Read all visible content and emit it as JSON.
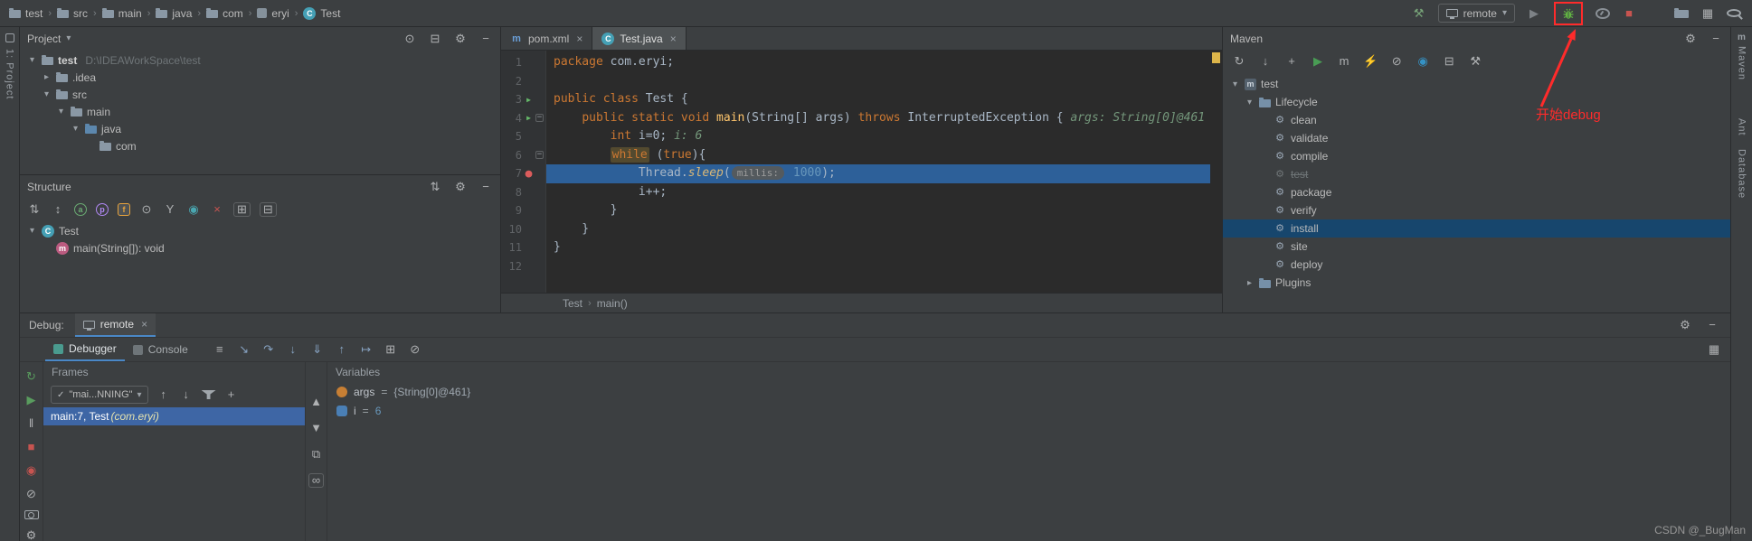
{
  "colors": {
    "panel_bg": "#3c3f41",
    "editor_bg": "#2b2b2b",
    "accent_blue": "#4a88c7",
    "selection_blue": "#3e66a5",
    "selection_dark": "#17466d",
    "execution_line_blue": "#2d6099",
    "keyword_orange": "#cc7832",
    "number_blue": "#6897bb",
    "inline_hint_green": "#74977b",
    "error_red": "#c75450",
    "run_green": "#499c54",
    "annotation_red": "#ff2b2b"
  },
  "icons": {
    "run": "▶",
    "stop": "■",
    "pause": "‖",
    "rerun": "↻",
    "gear": "⚙",
    "minus": "−",
    "close": "×",
    "chev_down": "▾",
    "chev_right": "▸",
    "sep": "›",
    "check": "✓",
    "up": "↑",
    "down": "↓",
    "plus": "+",
    "grid": "⊞",
    "layout": "▦",
    "bullseye": "⊙",
    "mute": "⊘",
    "infinity": "∞",
    "copy": "⧉",
    "tri_up": "▲",
    "tri_down": "▼",
    "sort": "⇅",
    "sort2": "↕",
    "step_over": "↷",
    "step_into": "↓",
    "force_step": "⇓",
    "step_out": "↑",
    "run_cursor": "↦",
    "show_exec": "↘",
    "hammer": "⚒",
    "lightning": "⚡",
    "circle": "◉",
    "dot": "●",
    "menu": "≡",
    "collapse": "⊟",
    "m_letter": "m",
    "a_letter": "a",
    "p_letter": "p",
    "f_letter": "f",
    "y_letter": "Y"
  },
  "top": {
    "breadcrumbs": [
      {
        "icon": "folder",
        "label": "test"
      },
      {
        "icon": "folder",
        "label": "src"
      },
      {
        "icon": "folder",
        "label": "main"
      },
      {
        "icon": "folder",
        "label": "java"
      },
      {
        "icon": "folder",
        "label": "com"
      },
      {
        "icon": "package",
        "label": "eryi"
      },
      {
        "icon": "class",
        "label": "Test"
      }
    ],
    "run_config": "remote",
    "annotation": "开始debug"
  },
  "left_stripe": {
    "label": "1: Project"
  },
  "project": {
    "header": "Project",
    "header_icons": [
      {
        "name": "locate-file-icon",
        "icon": "bullseye"
      },
      {
        "name": "collapse-all-icon",
        "icon": "collapse"
      },
      {
        "name": "settings-gear-icon",
        "icon": "gear"
      },
      {
        "name": "hide-panel-icon",
        "icon": "minus"
      }
    ],
    "tree": [
      {
        "indent": 0,
        "chev": "open",
        "icon": "folder",
        "label": "test",
        "bold": true,
        "extra": "D:\\IDEAWorkSpace\\test"
      },
      {
        "indent": 1,
        "chev": "closed",
        "icon": "folder",
        "label": ".idea"
      },
      {
        "indent": 1,
        "chev": "open",
        "icon": "folder",
        "label": "src"
      },
      {
        "indent": 2,
        "chev": "open",
        "icon": "folder",
        "label": "main"
      },
      {
        "indent": 3,
        "chev": "open",
        "icon": "folder-src",
        "label": "java"
      },
      {
        "indent": 4,
        "chev": "none",
        "icon": "folder",
        "label": "com"
      }
    ]
  },
  "structure": {
    "header": "Structure",
    "header_icons": [
      {
        "name": "sort-icon",
        "icon": "sort"
      },
      {
        "name": "settings-gear-icon",
        "icon": "gear"
      },
      {
        "name": "hide-panel-icon",
        "icon": "minus"
      }
    ],
    "toolbar_icons": [
      {
        "name": "sort-alphabetically-icon",
        "icon": "sort"
      },
      {
        "name": "sort-by-visibility-icon",
        "icon": "sort2"
      },
      {
        "name": "show-anonymous-classes-icon",
        "icon": "a_letter",
        "color": "#6aab73",
        "circle": true
      },
      {
        "name": "show-properties-icon",
        "icon": "p_letter",
        "color": "#b189f5",
        "circle": true
      },
      {
        "name": "show-fields-icon",
        "icon": "f_letter",
        "color": "#e8a33d",
        "circle": true,
        "active": true
      },
      {
        "name": "scroll-to-source-icon",
        "icon": "bullseye"
      },
      {
        "name": "show-inherited-icon",
        "icon": "y_letter"
      },
      {
        "name": "expand-node-icon",
        "icon": "circle",
        "color": "#49a6b0"
      },
      {
        "name": "remove-icon",
        "icon": "close",
        "color": "#c75450"
      },
      {
        "name": "autoscroll-to-source-icon",
        "icon": "grid",
        "boxed": true
      },
      {
        "name": "autoscroll-from-source-icon",
        "icon": "collapse",
        "boxed": true
      }
    ],
    "tree": [
      {
        "indent": 0,
        "chev": "open",
        "icon": "class",
        "label": "Test"
      },
      {
        "indent": 1,
        "chev": "none",
        "icon": "method",
        "label": "main(String[]): void"
      }
    ]
  },
  "editor": {
    "tabs": [
      {
        "icon": "maven-file",
        "label": "pom.xml",
        "close": true
      },
      {
        "icon": "class",
        "label": "Test.java",
        "close": true,
        "selected": true
      }
    ],
    "lines": [
      {
        "n": 1,
        "seg": [
          [
            "kw",
            "package"
          ],
          [
            "pl",
            " com.eryi;"
          ]
        ]
      },
      {
        "n": 2,
        "seg": []
      },
      {
        "n": 3,
        "run": true,
        "seg": [
          [
            "kw",
            "public class"
          ],
          [
            "pl",
            " Test {"
          ]
        ]
      },
      {
        "n": 4,
        "run": true,
        "fold": true,
        "seg": [
          [
            "pl",
            "    "
          ],
          [
            "kw",
            "public static void"
          ],
          [
            "fn",
            " main"
          ],
          [
            "pl",
            "(String[] args) "
          ],
          [
            "kw",
            "throws"
          ],
          [
            "pl",
            " InterruptedException { "
          ],
          [
            "hint",
            "args: String[0]@461"
          ]
        ]
      },
      {
        "n": 5,
        "seg": [
          [
            "pl",
            "        "
          ],
          [
            "kw",
            "int"
          ],
          [
            "pl",
            " i=0; "
          ],
          [
            "hint",
            "i: 6"
          ]
        ]
      },
      {
        "n": 6,
        "fold": true,
        "seg": [
          [
            "pl",
            "        "
          ],
          [
            "kwh",
            "while"
          ],
          [
            "pl",
            " ("
          ],
          [
            "kw",
            "true"
          ],
          [
            "pl",
            "){"
          ]
        ]
      },
      {
        "n": 7,
        "bp": true,
        "exec": true,
        "seg": [
          [
            "pl",
            "            Thread."
          ],
          [
            "fni",
            "sleep"
          ],
          [
            "pl",
            "("
          ],
          [
            "chip",
            "millis:"
          ],
          [
            "num",
            " 1000"
          ],
          [
            "pl",
            ");"
          ]
        ]
      },
      {
        "n": 8,
        "seg": [
          [
            "pl",
            "            i++;"
          ]
        ]
      },
      {
        "n": 9,
        "seg": [
          [
            "pl",
            "        }"
          ]
        ]
      },
      {
        "n": 10,
        "seg": [
          [
            "pl",
            "    }"
          ]
        ]
      },
      {
        "n": 11,
        "seg": [
          [
            "pl",
            "}"
          ]
        ]
      },
      {
        "n": 12,
        "seg": []
      }
    ],
    "breadcrumb": [
      {
        "label": "Test"
      },
      {
        "label": "main()"
      }
    ]
  },
  "maven": {
    "header": "Maven",
    "header_icons": [
      {
        "name": "settings-gear-icon",
        "icon": "gear"
      },
      {
        "name": "hide-panel-icon",
        "icon": "minus"
      }
    ],
    "toolbar_icons": [
      {
        "name": "reimport-maven-icon",
        "icon": "rerun"
      },
      {
        "name": "download-sources-icon",
        "icon": "down"
      },
      {
        "name": "add-maven-project-icon",
        "icon": "plus"
      },
      {
        "name": "run-maven-build-icon",
        "icon": "run",
        "color": "#499c54"
      },
      {
        "name": "execute-maven-goal-icon",
        "icon": "m_letter"
      },
      {
        "name": "toggle-offline-icon",
        "icon": "lightning"
      },
      {
        "name": "skip-tests-icon",
        "icon": "mute"
      },
      {
        "name": "show-dependencies-icon",
        "icon": "circle",
        "color": "#3592c4"
      },
      {
        "name": "collapse-all-icon",
        "icon": "collapse"
      },
      {
        "name": "maven-settings-icon",
        "icon": "hammer"
      }
    ],
    "tree": [
      {
        "indent": 0,
        "chev": "open",
        "icon": "maven-project",
        "label": "test"
      },
      {
        "indent": 1,
        "chev": "open",
        "icon": "lifecycle",
        "label": "Lifecycle"
      },
      {
        "indent": 2,
        "chev": "none",
        "icon": "goal",
        "label": "clean"
      },
      {
        "indent": 2,
        "chev": "none",
        "icon": "goal",
        "label": "validate"
      },
      {
        "indent": 2,
        "chev": "none",
        "icon": "goal",
        "label": "compile"
      },
      {
        "indent": 2,
        "chev": "none",
        "icon": "goal",
        "label": "test",
        "strike": true
      },
      {
        "indent": 2,
        "chev": "none",
        "icon": "goal",
        "label": "package"
      },
      {
        "indent": 2,
        "chev": "none",
        "icon": "goal",
        "label": "verify"
      },
      {
        "indent": 2,
        "chev": "none",
        "icon": "goal",
        "label": "install",
        "selected": true
      },
      {
        "indent": 2,
        "chev": "none",
        "icon": "goal",
        "label": "site"
      },
      {
        "indent": 2,
        "chev": "none",
        "icon": "goal",
        "label": "deploy"
      },
      {
        "indent": 1,
        "chev": "closed",
        "icon": "lifecycle",
        "label": "Plugins"
      }
    ]
  },
  "right_stripe": {
    "items": [
      {
        "icon": "m_letter",
        "label": "Maven"
      },
      {
        "label": "Ant"
      },
      {
        "label": "Database"
      }
    ]
  },
  "debug": {
    "title": "Debug:",
    "tab": "remote",
    "header_icons": [
      {
        "name": "settings-gear-icon",
        "icon": "gear"
      },
      {
        "name": "hide-panel-icon",
        "icon": "minus"
      }
    ],
    "tabs": [
      {
        "icon": "debugger",
        "label": "Debugger",
        "selected": true
      },
      {
        "icon": "console",
        "label": "Console"
      }
    ],
    "toolbar_icons": [
      {
        "name": "layout-settings-icon",
        "icon": "menu",
        "color": "#afb1b3"
      },
      {
        "name": "show-execution-point-icon",
        "icon": "show_exec"
      },
      {
        "name": "step-over-icon",
        "icon": "step_over"
      },
      {
        "name": "step-into-icon",
        "icon": "step_into"
      },
      {
        "name": "force-step-into-icon",
        "icon": "force_step"
      },
      {
        "name": "step-out-icon",
        "icon": "step_out"
      },
      {
        "name": "run-to-cursor-icon",
        "icon": "run_cursor"
      },
      {
        "name": "view-breakpoints-icon",
        "icon": "grid",
        "color": "#afb1b3"
      },
      {
        "name": "mute-breakpoints-icon",
        "icon": "mute",
        "color": "#afb1b3"
      }
    ],
    "side_icons": [
      {
        "name": "rerun-icon",
        "icon": "rerun",
        "color": "#599c5e"
      },
      {
        "name": "resume-icon",
        "icon": "run",
        "color": "#599c5e"
      },
      {
        "name": "pause-icon",
        "icon": "pause"
      },
      {
        "name": "stop-icon",
        "icon": "stop",
        "color": "#c75450"
      },
      {
        "name": "view-breakpoints-icon",
        "icon": "circle",
        "color": "#c75450"
      },
      {
        "name": "mute-breakpoints-icon",
        "icon": "mute"
      },
      {
        "name": "thread-dump-icon",
        "css": "ic-camera"
      },
      {
        "name": "settings-gear-icon",
        "icon": "gear",
        "bottom": true
      }
    ],
    "frames": {
      "header": "Frames",
      "thread_dropdown": "\"mai...NNING\"",
      "toolbar_icons": [
        {
          "name": "previous-frame-icon",
          "icon": "up"
        },
        {
          "name": "next-frame-icon",
          "icon": "down"
        },
        {
          "name": "filter-frames-icon",
          "css": "ic-funnel"
        },
        {
          "name": "add-watch-icon",
          "icon": "plus"
        }
      ],
      "rows": [
        {
          "text": "main:7, Test ",
          "pkg": "(com.eryi)",
          "selected": true
        }
      ]
    },
    "variables": {
      "header": "Variables",
      "side_icons": [
        {
          "name": "scroll-up-icon",
          "icon": "tri_up"
        },
        {
          "name": "scroll-down-icon",
          "icon": "tri_down"
        },
        {
          "name": "copy-value-icon",
          "icon": "copy"
        },
        {
          "name": "watch-return-values-icon",
          "icon": "infinity",
          "boxed": true
        }
      ],
      "rows": [
        {
          "icon": "parameter",
          "name": "args",
          "eq": "=",
          "value": "{String[0]@461}",
          "vclass": "ref"
        },
        {
          "icon": "primitive",
          "name": "i",
          "eq": "=",
          "value": "6",
          "vclass": "num"
        }
      ]
    }
  },
  "watermark": "CSDN @_BugMan"
}
